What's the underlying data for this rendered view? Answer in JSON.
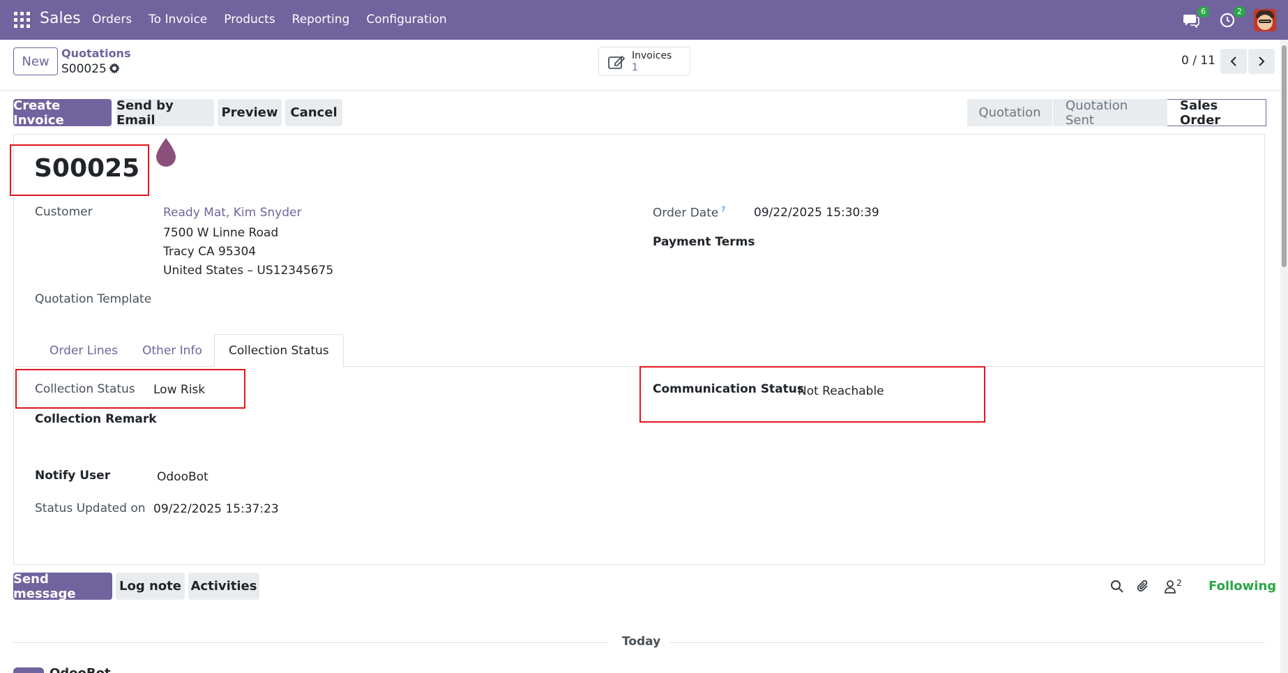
{
  "navbar": {
    "brand": "Sales",
    "menu": [
      "Orders",
      "To Invoice",
      "Products",
      "Reporting",
      "Configuration"
    ],
    "messages_count": "6",
    "activities_count": "2"
  },
  "control": {
    "new_label": "New",
    "breadcrumb": "Quotations",
    "record": "S00025",
    "smart_button": {
      "label": "Invoices",
      "value": "1"
    },
    "pager": "0 / 11"
  },
  "actions": {
    "create_invoice": "Create Invoice",
    "send_email": "Send by Email",
    "preview": "Preview",
    "cancel": "Cancel"
  },
  "status": {
    "stages": [
      "Quotation",
      "Quotation Sent",
      "Sales Order"
    ],
    "active": "Sales Order"
  },
  "form": {
    "title": "S00025",
    "customer_label": "Customer",
    "customer_name": "Ready Mat, Kim Snyder",
    "address_lines": [
      "7500 W Linne Road",
      "Tracy CA 95304",
      "United States – US12345675"
    ],
    "quotation_template_label": "Quotation Template",
    "order_date_label": "Order Date",
    "help_mark": "?",
    "order_date_value": "09/22/2025 15:30:39",
    "payment_terms_label": "Payment Terms"
  },
  "tabs": [
    "Order Lines",
    "Other Info",
    "Collection Status"
  ],
  "collection": {
    "status_label": "Collection Status",
    "status_value": "Low Risk",
    "remark_label": "Collection Remark",
    "comm_label": "Communication Status",
    "comm_value": "Not Reachable",
    "notify_label": "Notify User",
    "notify_value": "OdooBot",
    "updated_label": "Status Updated on",
    "updated_value": "09/22/2025 15:37:23"
  },
  "chatter": {
    "send_message": "Send message",
    "log_note": "Log note",
    "activities": "Activities",
    "followers_count": "2",
    "following": "Following",
    "today": "Today",
    "author": "OdooBot"
  },
  "colors": {
    "brand": "#71639e",
    "highlight": "#e0161e",
    "following": "#28a745"
  }
}
